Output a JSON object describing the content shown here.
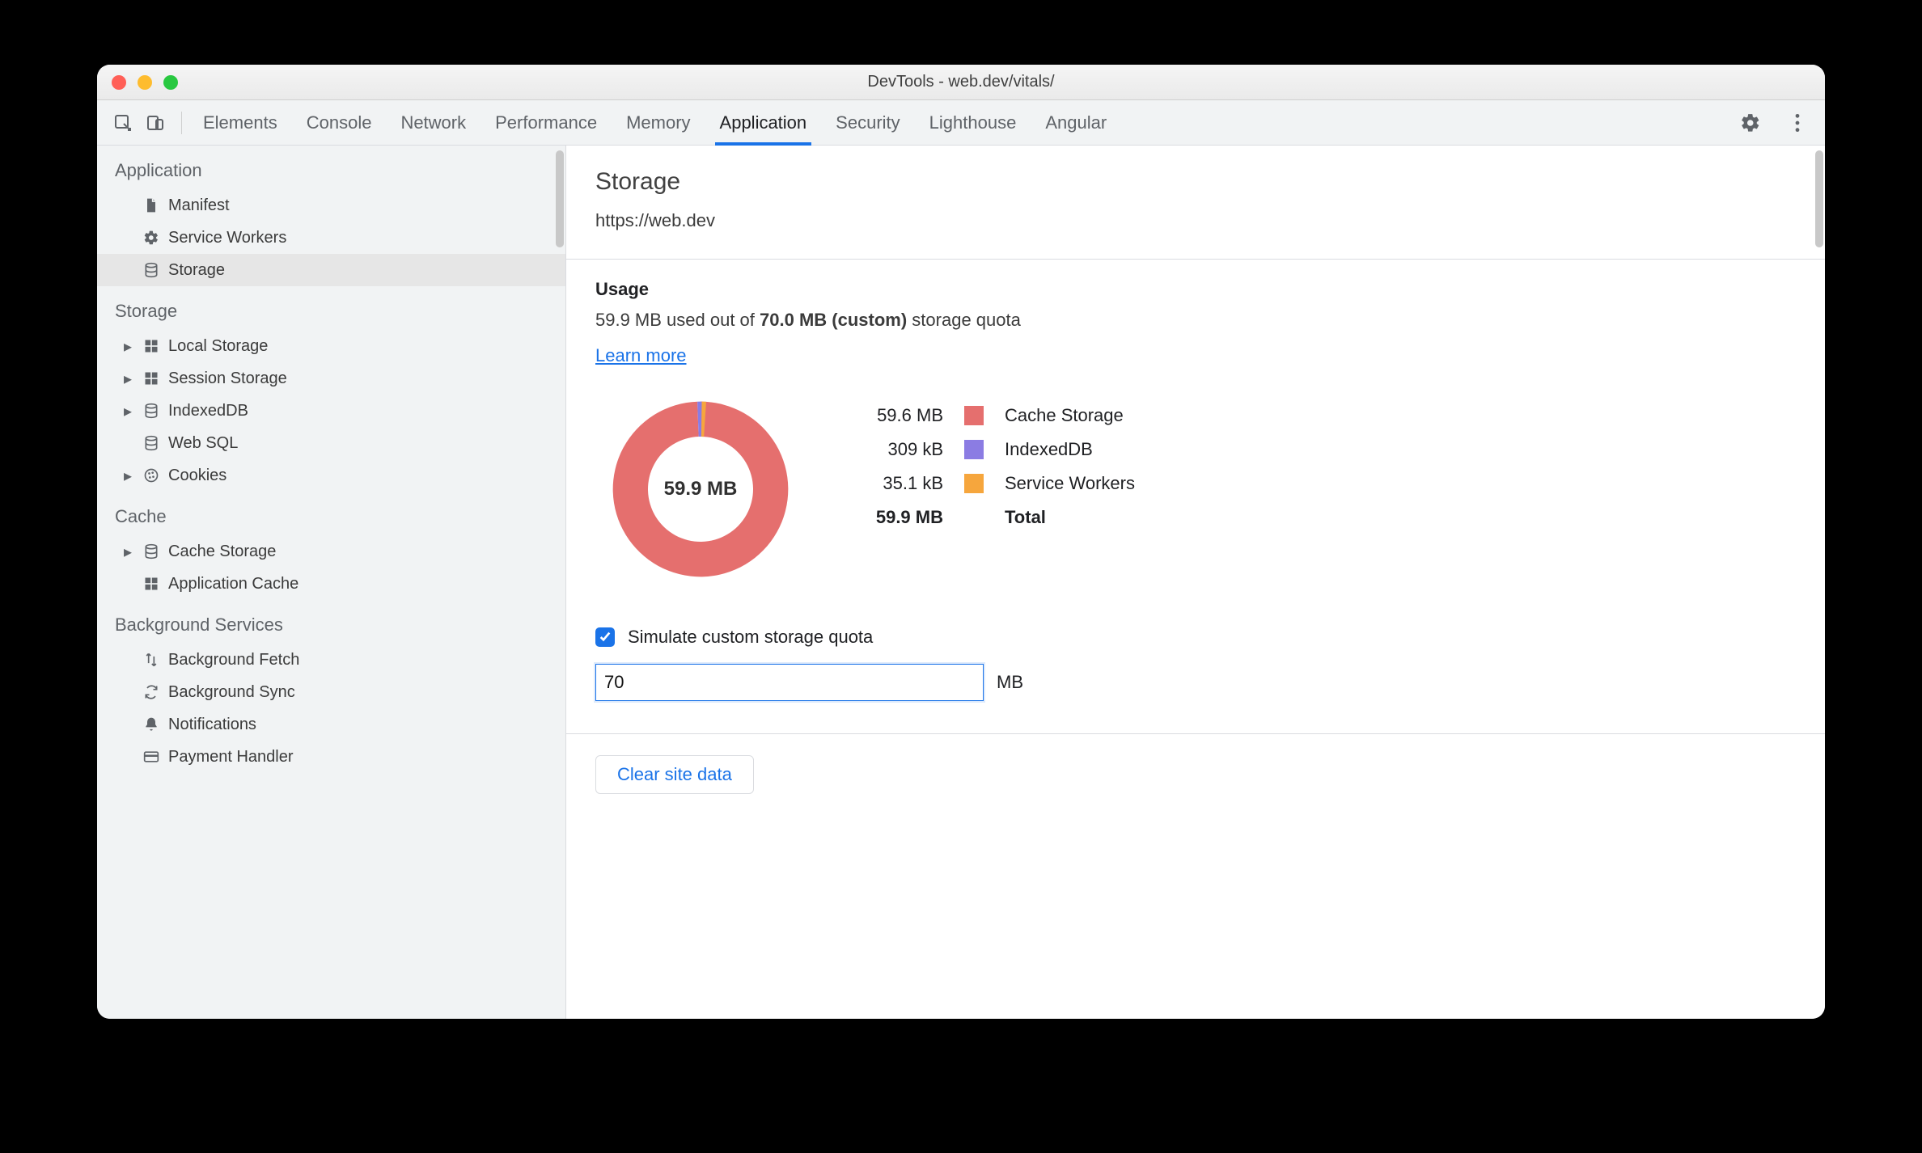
{
  "window": {
    "title": "DevTools - web.dev/vitals/"
  },
  "tabs": [
    "Elements",
    "Console",
    "Network",
    "Performance",
    "Memory",
    "Application",
    "Security",
    "Lighthouse",
    "Angular"
  ],
  "active_tab": "Application",
  "sidebar": {
    "sections": [
      {
        "title": "Application",
        "items": [
          {
            "label": "Manifest",
            "icon": "file-icon",
            "interactable": true,
            "expandable": false
          },
          {
            "label": "Service Workers",
            "icon": "gear-icon",
            "interactable": true,
            "expandable": false
          },
          {
            "label": "Storage",
            "icon": "db-icon",
            "interactable": true,
            "expandable": false,
            "selected": true
          }
        ]
      },
      {
        "title": "Storage",
        "items": [
          {
            "label": "Local Storage",
            "icon": "grid-icon",
            "interactable": true,
            "expandable": true
          },
          {
            "label": "Session Storage",
            "icon": "grid-icon",
            "interactable": true,
            "expandable": true
          },
          {
            "label": "IndexedDB",
            "icon": "db-icon",
            "interactable": true,
            "expandable": true
          },
          {
            "label": "Web SQL",
            "icon": "db-icon",
            "interactable": true,
            "expandable": false
          },
          {
            "label": "Cookies",
            "icon": "cookie-icon",
            "interactable": true,
            "expandable": true
          }
        ]
      },
      {
        "title": "Cache",
        "items": [
          {
            "label": "Cache Storage",
            "icon": "db-icon",
            "interactable": true,
            "expandable": true
          },
          {
            "label": "Application Cache",
            "icon": "grid-icon",
            "interactable": true,
            "expandable": false
          }
        ]
      },
      {
        "title": "Background Services",
        "items": [
          {
            "label": "Background Fetch",
            "icon": "arrows-icon",
            "interactable": true,
            "expandable": false
          },
          {
            "label": "Background Sync",
            "icon": "sync-icon",
            "interactable": true,
            "expandable": false
          },
          {
            "label": "Notifications",
            "icon": "bell-icon",
            "interactable": true,
            "expandable": false
          },
          {
            "label": "Payment Handler",
            "icon": "card-icon",
            "interactable": true,
            "expandable": false
          }
        ]
      }
    ]
  },
  "main": {
    "heading": "Storage",
    "origin": "https://web.dev",
    "usage_heading": "Usage",
    "usage_prefix": "59.9 MB used out of ",
    "usage_bold": "70.0 MB (custom)",
    "usage_suffix": " storage quota",
    "learn_more": "Learn more",
    "donut_center": "59.9 MB",
    "total_label": "Total",
    "total_value": "59.9 MB",
    "legend": [
      {
        "value": "59.6 MB",
        "label": "Cache Storage",
        "color": "#e56f6e"
      },
      {
        "value": "309 kB",
        "label": "IndexedDB",
        "color": "#8b7ce3"
      },
      {
        "value": "35.1 kB",
        "label": "Service Workers",
        "color": "#f6a63d"
      }
    ],
    "simulate_label": "Simulate custom storage quota",
    "simulate_checked": true,
    "quota_value": "70",
    "quota_suffix": "MB",
    "clear_label": "Clear site data"
  },
  "chart_data": {
    "type": "pie",
    "title": "Storage usage breakdown",
    "unit": "bytes",
    "total_display": "59.9 MB",
    "series": [
      {
        "name": "Cache Storage",
        "value": 59600000,
        "display": "59.6 MB",
        "color": "#e56f6e"
      },
      {
        "name": "IndexedDB",
        "value": 309000,
        "display": "309 kB",
        "color": "#8b7ce3"
      },
      {
        "name": "Service Workers",
        "value": 35100,
        "display": "35.1 kB",
        "color": "#f6a63d"
      }
    ]
  }
}
